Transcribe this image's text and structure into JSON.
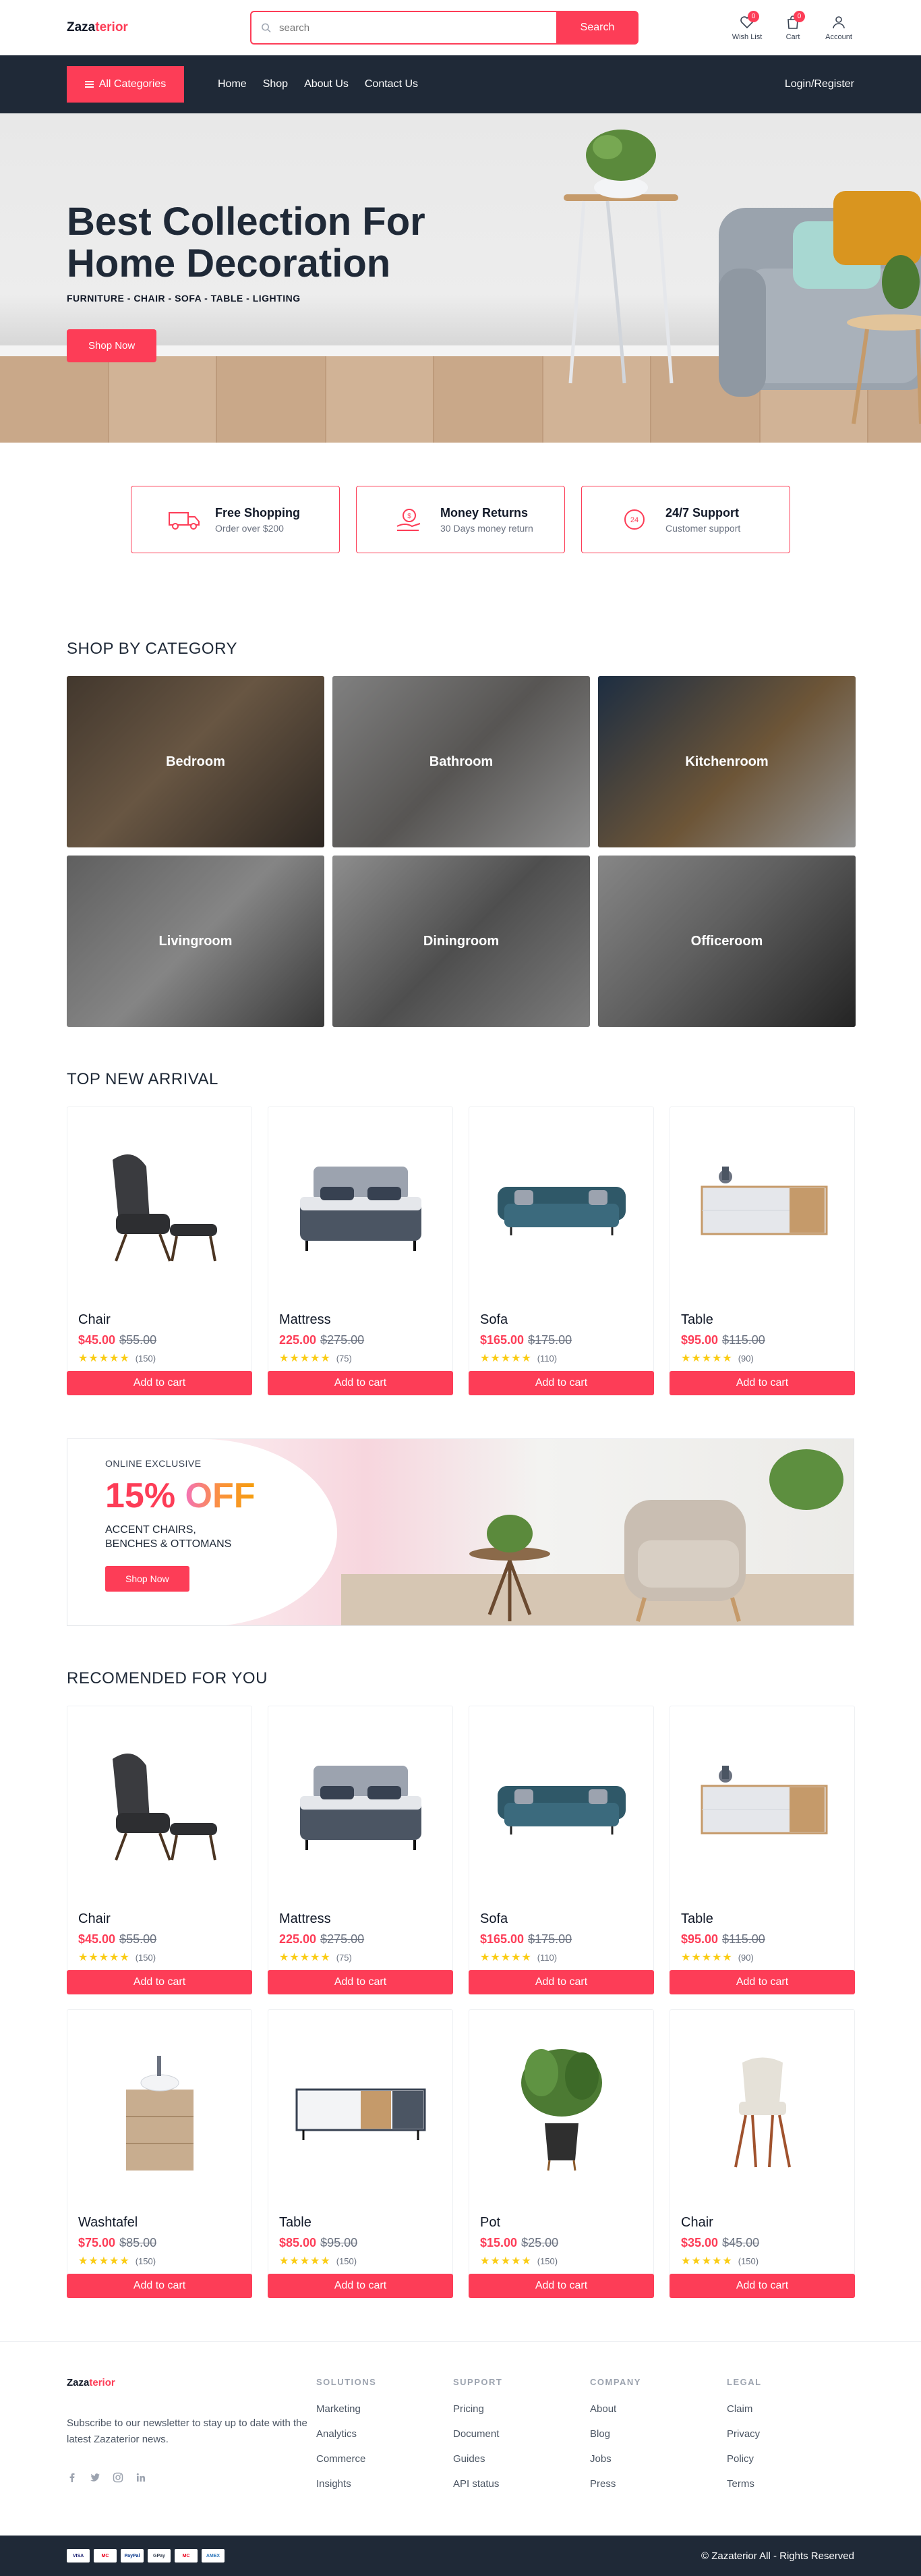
{
  "header": {
    "logo_main": "Zaza",
    "logo_accent": "terior",
    "search_placeholder": "search",
    "search_button": "Search",
    "icons": [
      {
        "label": "Wish List",
        "icon": "heart-icon",
        "badge": "0"
      },
      {
        "label": "Cart",
        "icon": "bag-icon",
        "badge": "0"
      },
      {
        "label": "Account",
        "icon": "user-icon",
        "badge": ""
      }
    ]
  },
  "nav": {
    "categories_button": "All Categories",
    "links": [
      "Home",
      "Shop",
      "About Us",
      "Contact Us"
    ],
    "login": "Login/Register"
  },
  "hero": {
    "title_line1": "Best Collection For",
    "title_line2": "Home Decoration",
    "subtitle": "FURNITURE - CHAIR - SOFA - TABLE - LIGHTING",
    "button": "Shop Now"
  },
  "features": [
    {
      "title": "Free Shopping",
      "subtitle": "Order over $200",
      "icon": "truck-icon"
    },
    {
      "title": "Money Returns",
      "subtitle": "30 Days money return",
      "icon": "money-return-icon"
    },
    {
      "title": "24/7 Support",
      "subtitle": "Customer support",
      "icon": "support-icon"
    }
  ],
  "categories": {
    "title": "SHOP BY CATEGORY",
    "items": [
      "Bedroom",
      "Bathroom",
      "Kitchenroom",
      "Livingroom",
      "Diningroom",
      "Officeroom"
    ]
  },
  "arrival": {
    "title": "TOP NEW ARRIVAL",
    "products": [
      {
        "name": "Chair",
        "price": "$45.00",
        "old_price": "$55.00",
        "stars": "★★★★★",
        "reviews": "(150)",
        "button": "Add to cart"
      },
      {
        "name": "Mattress",
        "price": "225.00",
        "old_price": "$275.00",
        "stars": "★★★★★",
        "reviews": "(75)",
        "button": "Add to cart"
      },
      {
        "name": "Sofa",
        "price": "$165.00",
        "old_price": "$175.00",
        "stars": "★★★★★",
        "reviews": "(110)",
        "button": "Add to cart"
      },
      {
        "name": "Table",
        "price": "$95.00",
        "old_price": "$115.00",
        "stars": "★★★★★",
        "reviews": "(90)",
        "button": "Add to cart"
      }
    ]
  },
  "promo": {
    "label": "ONLINE EXCLUSIVE",
    "percent": "15%",
    "off": "OFF",
    "desc_line1": "ACCENT CHAIRS,",
    "desc_line2": "BENCHES & OTTOMANS",
    "button": "Shop Now"
  },
  "recommended": {
    "title": "RECOMENDED FOR YOU",
    "products": [
      {
        "name": "Chair",
        "price": "$45.00",
        "old_price": "$55.00",
        "stars": "★★★★★",
        "reviews": "(150)",
        "button": "Add to cart"
      },
      {
        "name": "Mattress",
        "price": "225.00",
        "old_price": "$275.00",
        "stars": "★★★★★",
        "reviews": "(75)",
        "button": "Add to cart"
      },
      {
        "name": "Sofa",
        "price": "$165.00",
        "old_price": "$175.00",
        "stars": "★★★★★",
        "reviews": "(110)",
        "button": "Add to cart"
      },
      {
        "name": "Table",
        "price": "$95.00",
        "old_price": "$115.00",
        "stars": "★★★★★",
        "reviews": "(90)",
        "button": "Add to cart"
      },
      {
        "name": "Washtafel",
        "price": "$75.00",
        "old_price": "$85.00",
        "stars": "★★★★★",
        "reviews": "(150)",
        "button": "Add to cart"
      },
      {
        "name": "Table",
        "price": "$85.00",
        "old_price": "$95.00",
        "stars": "★★★★★",
        "reviews": "(150)",
        "button": "Add to cart"
      },
      {
        "name": "Pot",
        "price": "$15.00",
        "old_price": "$25.00",
        "stars": "★★★★★",
        "reviews": "(150)",
        "button": "Add to cart"
      },
      {
        "name": "Chair",
        "price": "$35.00",
        "old_price": "$45.00",
        "stars": "★★★★★",
        "reviews": "(150)",
        "button": "Add to cart"
      }
    ]
  },
  "footer": {
    "logo_main": "Zaza",
    "logo_accent": "terior",
    "description": "Subscribe to our newsletter to stay up to date with the latest Zazaterior news.",
    "columns": [
      {
        "title": "SOLUTIONS",
        "links": [
          "Marketing",
          "Analytics",
          "Commerce",
          "Insights"
        ]
      },
      {
        "title": "SUPPORT",
        "links": [
          "Pricing",
          "Document",
          "Guides",
          "API status"
        ]
      },
      {
        "title": "COMPANY",
        "links": [
          "About",
          "Blog",
          "Jobs",
          "Press"
        ]
      },
      {
        "title": "LEGAL",
        "links": [
          "Claim",
          "Privacy",
          "Policy",
          "Terms"
        ]
      }
    ],
    "payment_cards": [
      "VISA",
      "MC",
      "PayPal",
      "GPay",
      "MC",
      "AMEX"
    ],
    "copyright": "© Zazaterior All - Rights Reserved"
  },
  "colors": {
    "accent": "#fd3d57",
    "dark": "#1f2937",
    "star": "#facc15"
  }
}
